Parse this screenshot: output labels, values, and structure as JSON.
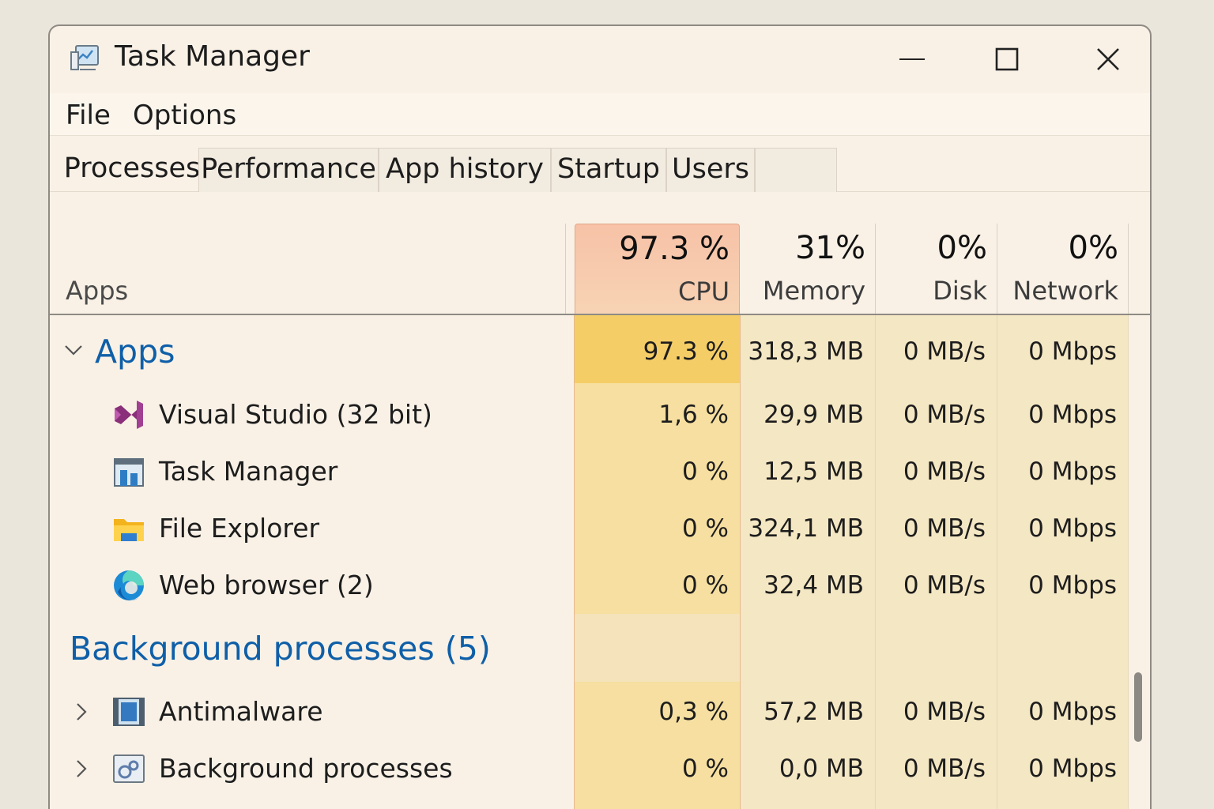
{
  "window": {
    "title": "Task Manager"
  },
  "icons": {
    "app": "task-manager-icon",
    "minimize": "minimize-icon",
    "maximize": "maximize-icon",
    "close": "close-icon",
    "collapse": "chevron-down-icon",
    "expand": "chevron-right-icon"
  },
  "menu": [
    "File",
    "Options"
  ],
  "tabs": [
    {
      "label": "Processes",
      "active": true
    },
    {
      "label": "Performance"
    },
    {
      "label": "App history"
    },
    {
      "label": "Startup"
    },
    {
      "label": "Users"
    },
    {
      "label": ""
    }
  ],
  "columns": {
    "name": {
      "label": "Apps"
    },
    "cpu": {
      "percent": "97.3 %",
      "label": "CPU"
    },
    "memory": {
      "percent": "31%",
      "label": "Memory"
    },
    "disk": {
      "percent": "0%",
      "label": "Disk"
    },
    "network": {
      "percent": "0%",
      "label": "Network"
    }
  },
  "groups": {
    "apps": {
      "title": "Apps",
      "totals": {
        "cpu": "97.3 %",
        "memory": "318,3 MB",
        "disk": "0 MB/s",
        "network": "0 Mbps"
      },
      "rows": [
        {
          "name": "Visual Studio (32 bit)",
          "icon": "visual-studio-icon",
          "cpu": "1,6 %",
          "memory": "29,9 MB",
          "disk": "0 MB/s",
          "network": "0 Mbps"
        },
        {
          "name": "Task Manager",
          "icon": "task-manager-icon",
          "cpu": "0 %",
          "memory": "12,5 MB",
          "disk": "0 MB/s",
          "network": "0 Mbps"
        },
        {
          "name": "File Explorer",
          "icon": "folder-icon",
          "cpu": "0 %",
          "memory": "324,1 MB",
          "disk": "0 MB/s",
          "network": "0 Mbps"
        },
        {
          "name": "Web browser (2)",
          "icon": "browser-icon",
          "cpu": "0 %",
          "memory": "32,4 MB",
          "disk": "0 MB/s",
          "network": "0 Mbps"
        }
      ]
    },
    "background": {
      "title": "Background processes (5)",
      "rows": [
        {
          "name": "Antimalware",
          "icon": "antimalware-icon",
          "cpu": "0,3 %",
          "memory": "57,2 MB",
          "disk": "0 MB/s",
          "network": "0 Mbps"
        },
        {
          "name": "Background processes",
          "icon": "background-process-icon",
          "cpu": "0 %",
          "memory": "0,0 MB",
          "disk": "0 MB/s",
          "network": "0 Mbps"
        }
      ]
    }
  },
  "colors": {
    "cpu_header": "#f6c4a8",
    "cpu_hot": "#f4cd67",
    "cpu_col": "#f6df9f",
    "other_col": "#f4e7c2",
    "group_title": "#0f5fa8"
  }
}
